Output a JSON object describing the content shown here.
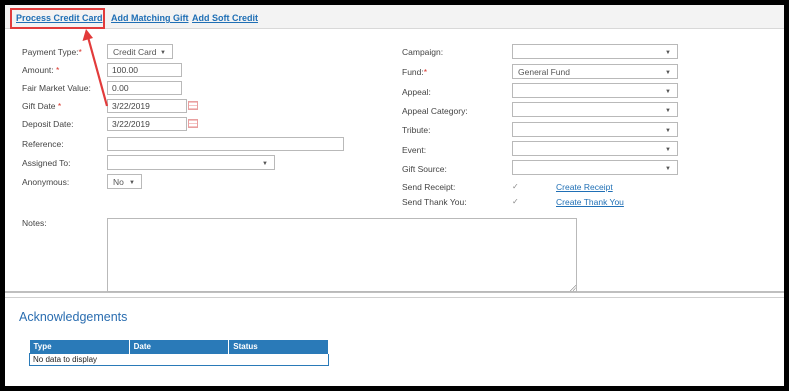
{
  "links": {
    "process_credit_card": "Process Credit Card",
    "add_matching_gift": "Add Matching Gift",
    "add_soft_credit": "Add Soft Credit"
  },
  "form": {
    "payment_type": {
      "label": "Payment Type:",
      "required": "*",
      "value": "Credit Card"
    },
    "amount": {
      "label": "Amount:",
      "required": "*",
      "value": "100.00"
    },
    "fair_market_value": {
      "label": "Fair Market Value:",
      "value": "0.00"
    },
    "gift_date": {
      "label": "Gift Date",
      "required": "*",
      "value": "3/22/2019"
    },
    "deposit_date": {
      "label": "Deposit Date:",
      "value": "3/22/2019"
    },
    "reference": {
      "label": "Reference:",
      "value": ""
    },
    "assigned_to": {
      "label": "Assigned To:",
      "value": ""
    },
    "anonymous": {
      "label": "Anonymous:",
      "value": "No"
    },
    "notes": {
      "label": "Notes:",
      "value": ""
    },
    "campaign": {
      "label": "Campaign:",
      "value": ""
    },
    "fund": {
      "label": "Fund:",
      "required": "*",
      "value": "General Fund"
    },
    "appeal": {
      "label": "Appeal:",
      "value": ""
    },
    "appeal_category": {
      "label": "Appeal Category:",
      "value": ""
    },
    "tribute": {
      "label": "Tribute:",
      "value": ""
    },
    "event": {
      "label": "Event:",
      "value": ""
    },
    "gift_source": {
      "label": "Gift Source:",
      "value": ""
    },
    "send_receipt": {
      "label": "Send Receipt:",
      "checked": true,
      "link": "Create Receipt"
    },
    "send_thank_you": {
      "label": "Send Thank You:",
      "checked": true,
      "link": "Create Thank You"
    }
  },
  "acknowledgements": {
    "title": "Acknowledgements",
    "columns": [
      "Type",
      "Date",
      "Status"
    ],
    "empty_text": "No data to display"
  },
  "icons": {
    "caret": "▼",
    "check": "✓"
  },
  "colors": {
    "link": "#1f6fb5",
    "required": "#d9342b",
    "annotation": "#e23b3b",
    "table_header": "#2a7ab8"
  }
}
